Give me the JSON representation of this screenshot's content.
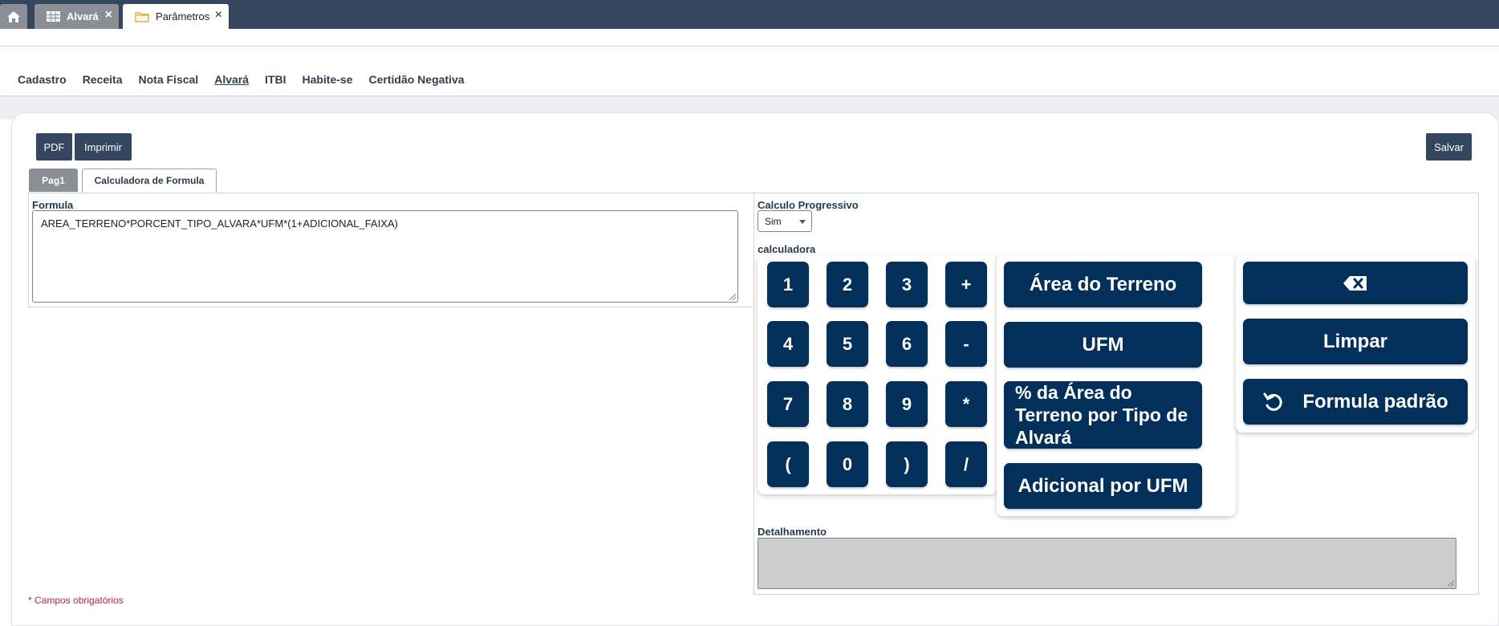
{
  "window_tabs": {
    "home_icon": "home-icon",
    "tabs": [
      {
        "label": "Alvará",
        "icon": "grid-icon",
        "close": "×"
      },
      {
        "label": "Parâmetros",
        "icon": "folder-icon",
        "close": "×"
      }
    ]
  },
  "menu": {
    "items": [
      "Cadastro",
      "Receita",
      "Nota Fiscal",
      "Alvará",
      "ITBI",
      "Habite-se",
      "Certidão Negativa"
    ],
    "current": "Alvará"
  },
  "toolbar": {
    "pdf_label": "PDF",
    "print_label": "Imprimir",
    "save_label": "Salvar"
  },
  "subtabs": {
    "pag1": "Pag1",
    "calculator": "Calculadora de Formula"
  },
  "form": {
    "formula_label": "Formula",
    "formula_value": "AREA_TERRENO*PORCENT_TIPO_ALVARA*UFM*(1+ADICIONAL_FAIXA)",
    "progressive_label": "Calculo Progressivo",
    "progressive_value": "Sim",
    "calculator_label": "calculadora",
    "detail_label": "Detalhamento",
    "required_note": "* Campos obrigatórios"
  },
  "calculator": {
    "keys": [
      "1",
      "2",
      "3",
      "+",
      "4",
      "5",
      "6",
      "-",
      "7",
      "8",
      "9",
      "*",
      "(",
      "0",
      ")",
      "/"
    ],
    "variables": [
      "Área do Terreno",
      "UFM",
      "% da Área do Terreno por Tipo de Alvará",
      "Adicional por UFM"
    ],
    "actions": {
      "backspace_icon": "backspace-icon",
      "clear": "Limpar",
      "reset_icon": "undo-icon",
      "reset": "Formula padrão"
    }
  },
  "colors": {
    "topbar": "#34475e",
    "key_bg": "#03305a",
    "required": "#b0283a"
  }
}
